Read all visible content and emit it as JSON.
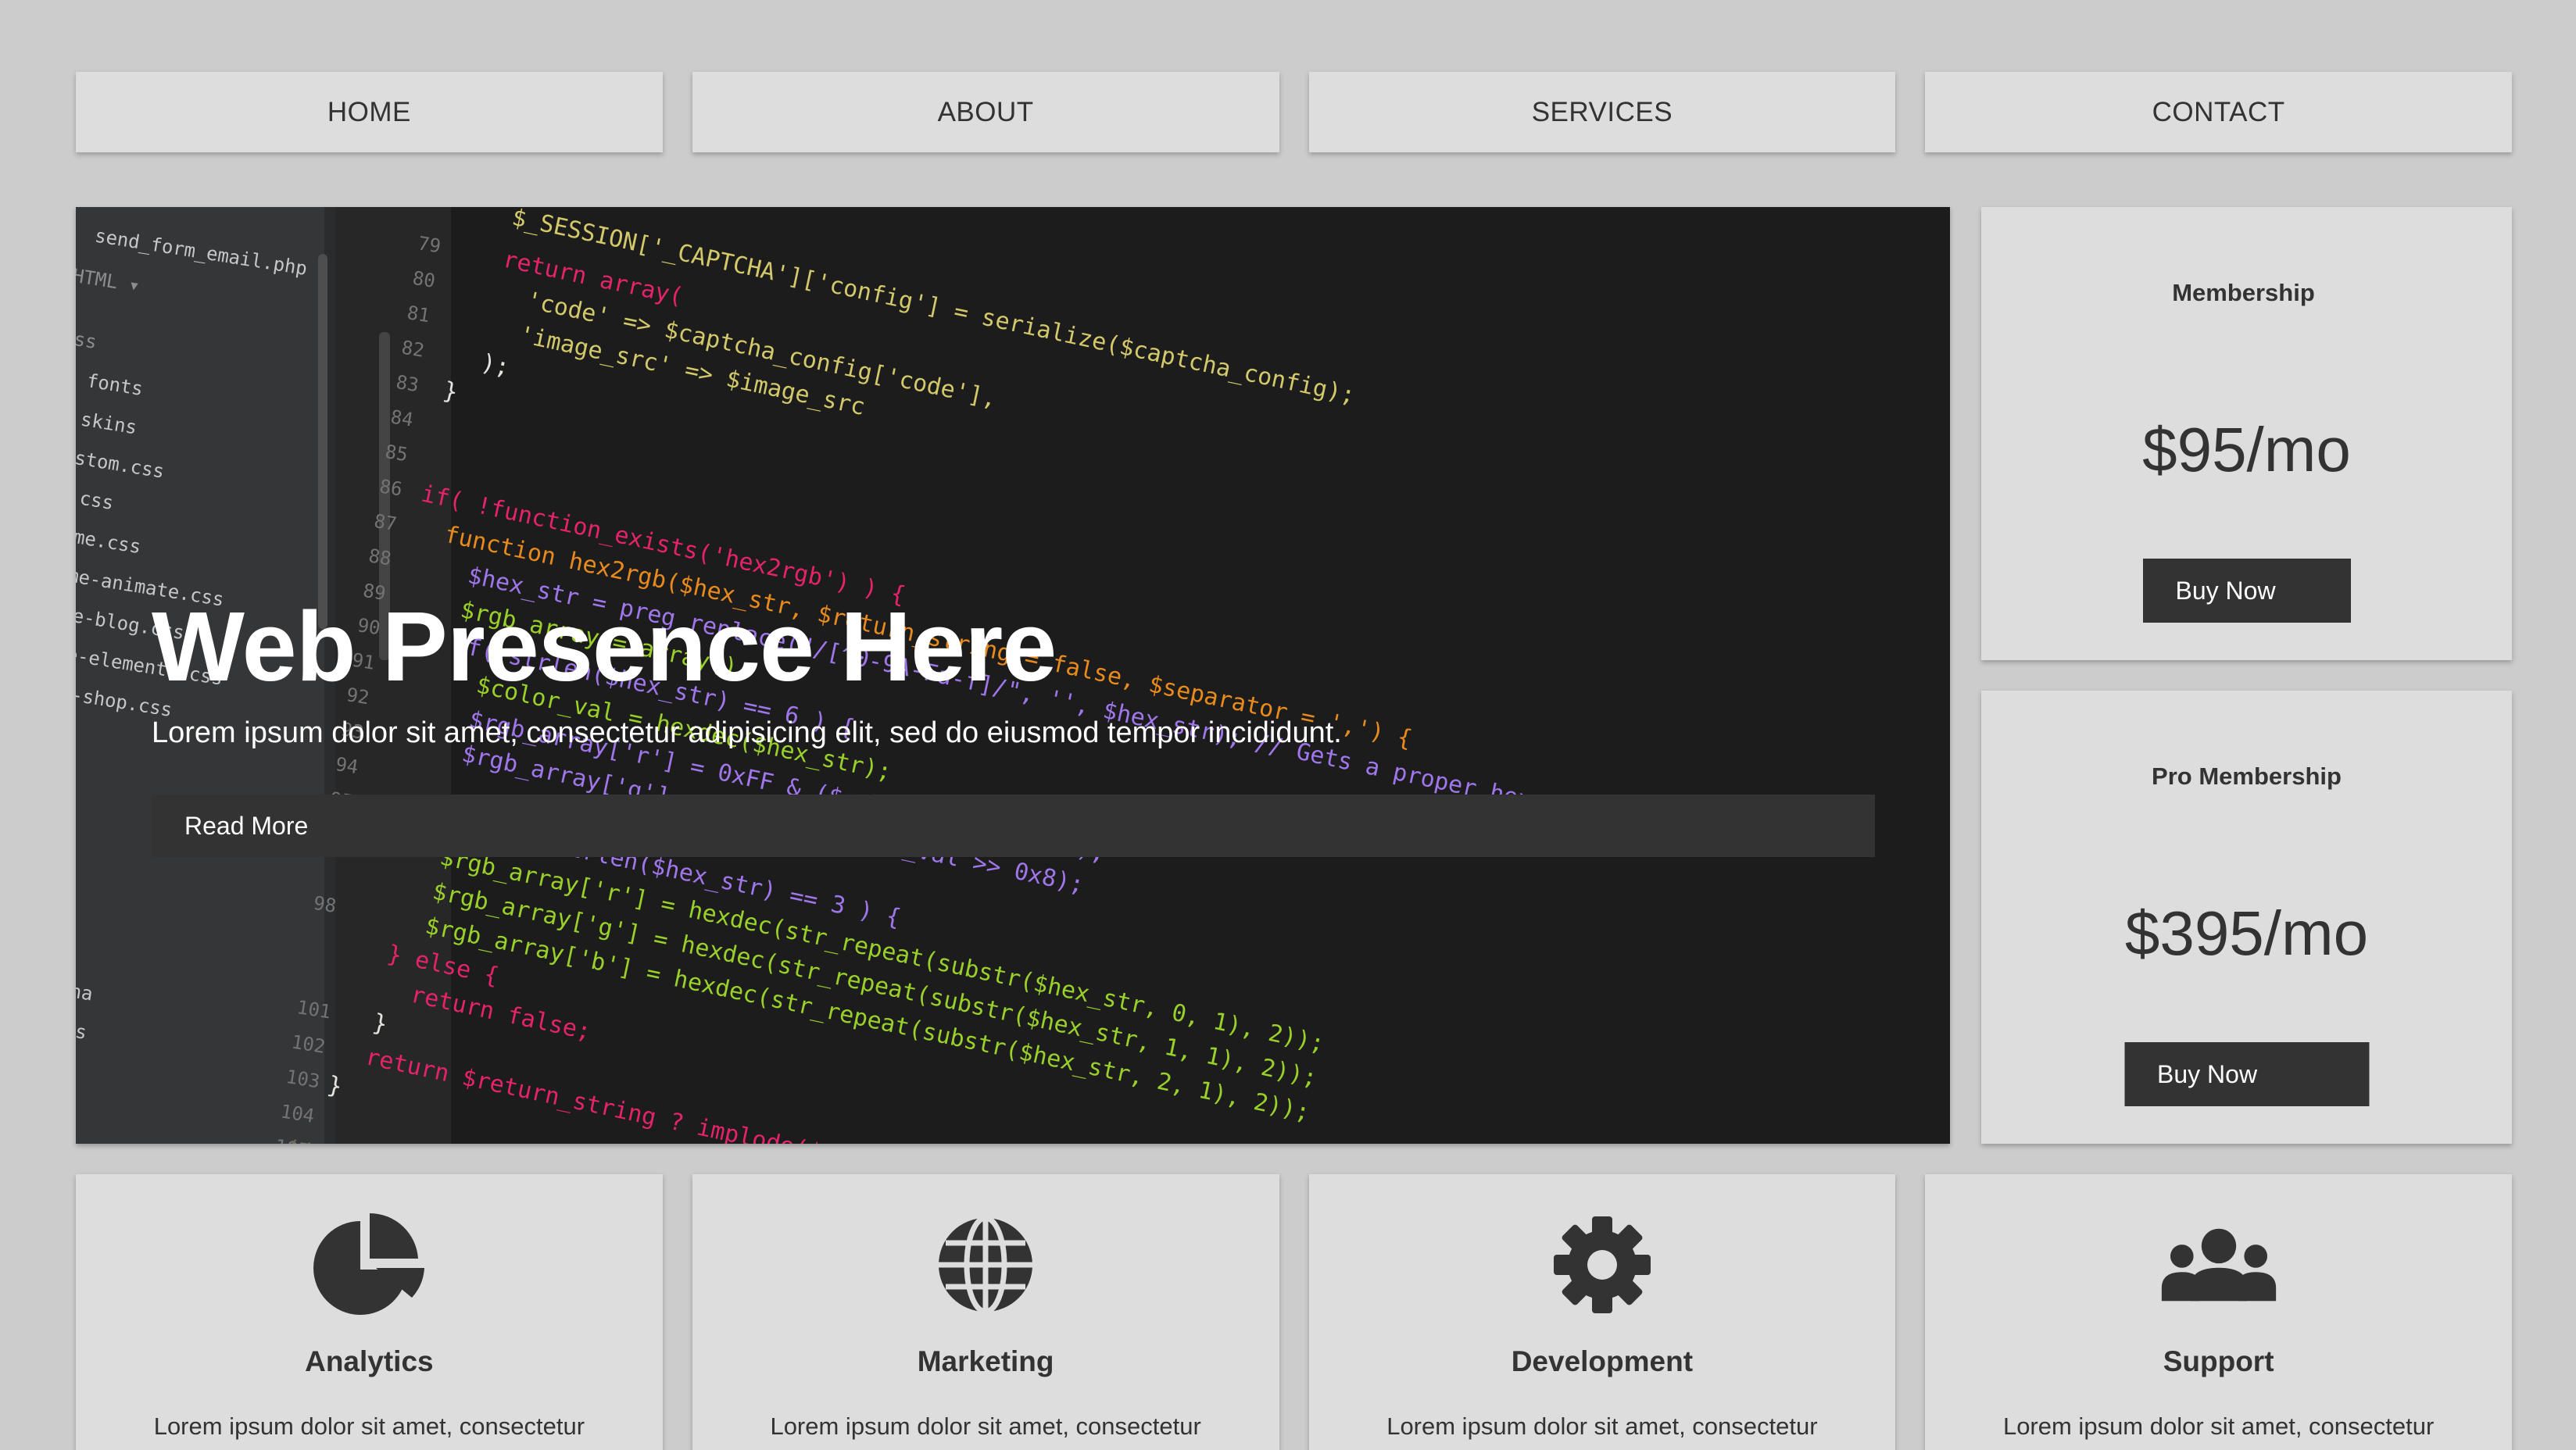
{
  "nav": {
    "items": [
      {
        "label": "HOME"
      },
      {
        "label": "ABOUT"
      },
      {
        "label": "SERVICES"
      },
      {
        "label": "CONTACT"
      }
    ]
  },
  "hero": {
    "title": "Web Presence Here",
    "subtitle": "Lorem ipsum dolor sit amet, consectetur adipisicing elit, sed do eiusmod tempor incididunt.",
    "button_label": "Read More",
    "background_image": "code-editor-screenshot"
  },
  "pricing": [
    {
      "name": "Membership",
      "price": "$95/mo",
      "button_label": "Buy Now"
    },
    {
      "name": "Pro Membership",
      "price": "$395/mo",
      "button_label": "Buy Now"
    }
  ],
  "features": [
    {
      "icon": "pie-chart-icon",
      "title": "Analytics",
      "text": "Lorem ipsum dolor sit amet, consectetur"
    },
    {
      "icon": "globe-icon",
      "title": "Marketing",
      "text": "Lorem ipsum dolor sit amet, consectetur"
    },
    {
      "icon": "gear-icon",
      "title": "Development",
      "text": "Lorem ipsum dolor sit amet, consectetur"
    },
    {
      "icon": "users-icon",
      "title": "Support",
      "text": "Lorem ipsum dolor sit amet, consectetur"
    }
  ],
  "colors": {
    "background": "#cccccc",
    "card": "#dddddd",
    "button": "#333333",
    "text": "#333333",
    "hero_bg": "#1f1f20"
  }
}
